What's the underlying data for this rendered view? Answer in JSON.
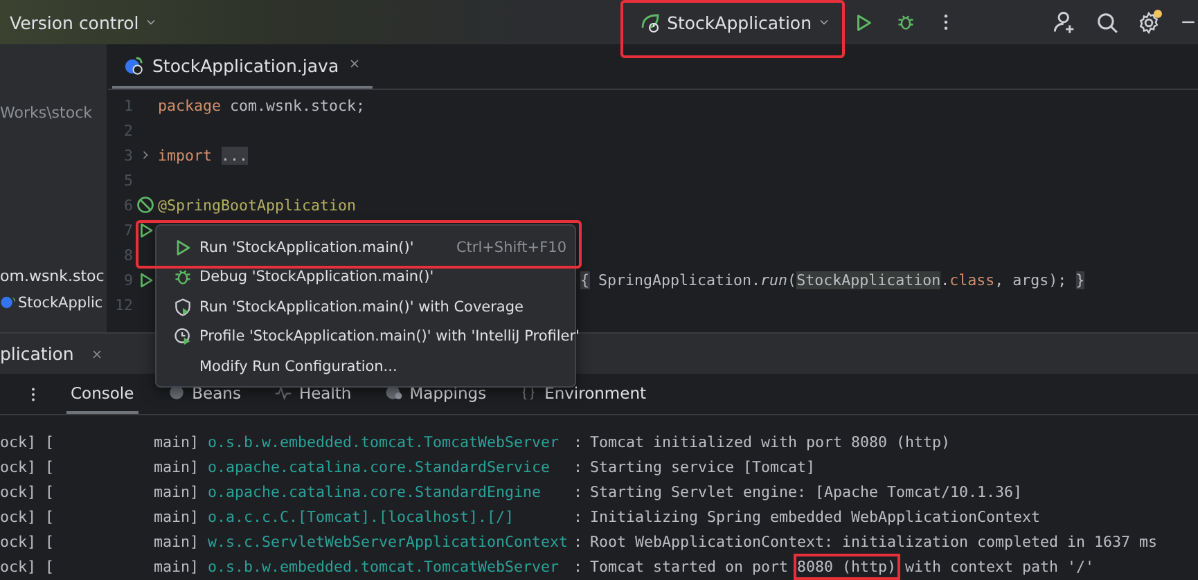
{
  "top_bar": {
    "project_menu": "Version control",
    "run_group": {
      "label": "StockApplication",
      "highlighted": true
    }
  },
  "project_pane": {
    "items": [
      {
        "text": "Works\\stock",
        "kind": "path"
      },
      {
        "text": "om.wsnk.stoc",
        "kind": "package"
      },
      {
        "text": "StockApplic",
        "kind": "class"
      }
    ]
  },
  "editor": {
    "tab": {
      "title": "StockApplication.java"
    },
    "lines": [
      {
        "number": "1",
        "kind": "plain",
        "covered": false,
        "tokens": [
          {
            "text": "package",
            "kind": "keyword"
          },
          {
            "text": " com.wsnk.stock;",
            "kind": "plain"
          }
        ]
      },
      {
        "number": "2",
        "kind": "plain"
      },
      {
        "number": "3",
        "kind": "fold",
        "covered": false,
        "tokens": [
          {
            "text": "import",
            "kind": "keyword"
          },
          {
            "text": "...",
            "kind": "folded"
          }
        ]
      },
      {
        "number": "5",
        "kind": "plain"
      },
      {
        "number": "6",
        "kind": "bean",
        "covered": false,
        "tokens": [
          {
            "text": "@SpringBootApplication",
            "kind": "annotation"
          }
        ]
      },
      {
        "number": "7",
        "kind": "run"
      },
      {
        "number": "8",
        "kind": "plain"
      },
      {
        "number": "9",
        "kind": "run",
        "covered": true,
        "tokens": [
          {
            "text": "{",
            "kind": "brace"
          },
          {
            "text": " SpringApplication.",
            "kind": "plain"
          },
          {
            "text": "run",
            "kind": "italic"
          },
          {
            "text": "(",
            "kind": "plain"
          },
          {
            "text": "StockApplication",
            "kind": "match"
          },
          {
            "text": ".",
            "kind": "plain"
          },
          {
            "text": "class",
            "kind": "keyword"
          },
          {
            "text": ", args); ",
            "kind": "plain"
          },
          {
            "text": "}",
            "kind": "brace"
          }
        ]
      },
      {
        "number": "12",
        "kind": "plain"
      }
    ]
  },
  "context_menu": {
    "items": [
      {
        "label": "Run 'StockApplication.main()'",
        "shortcut": "Ctrl+Shift+F10",
        "kind": "run",
        "highlighted": true
      },
      {
        "label": "Debug 'StockApplication.main()'",
        "kind": "debug",
        "highlighted": false
      },
      {
        "label": "Run 'StockApplication.main()' with Coverage",
        "kind": "coverage",
        "highlighted": false
      },
      {
        "label": "Profile 'StockApplication.main()' with 'IntelliJ Profiler'",
        "kind": "profiler",
        "highlighted": false
      },
      {
        "label": "Modify Run Configuration...",
        "kind": "plain",
        "highlighted": false
      }
    ]
  },
  "run_window": {
    "title": "plication",
    "tabs": [
      {
        "label": "Console",
        "kind": "plain",
        "selected": true
      },
      {
        "label": "Beans",
        "kind": "beans",
        "selected": false
      },
      {
        "label": "Health",
        "kind": "health",
        "selected": false
      },
      {
        "label": "Mappings",
        "kind": "mappings",
        "selected": false
      },
      {
        "label": "Environment",
        "kind": "environment",
        "selected": false
      }
    ],
    "log": [
      {
        "source": "ock] [",
        "thread": "main]",
        "logger": "o.s.b.w.embedded.tomcat.TomcatWebServer",
        "separator": ":",
        "message": [
          {
            "text": "Tomcat initialized with port 8080 (http)",
            "highlighted": false
          }
        ]
      },
      {
        "source": "ock] [",
        "thread": "main]",
        "logger": "o.apache.catalina.core.StandardService",
        "separator": ":",
        "message": [
          {
            "text": "Starting service [Tomcat]",
            "highlighted": false
          }
        ]
      },
      {
        "source": "ock] [",
        "thread": "main]",
        "logger": "o.apache.catalina.core.StandardEngine",
        "separator": ":",
        "message": [
          {
            "text": "Starting Servlet engine: [Apache Tomcat/10.1.36]",
            "highlighted": false
          }
        ]
      },
      {
        "source": "ock] [",
        "thread": "main]",
        "logger": "o.a.c.c.C.[Tomcat].[localhost].[/]",
        "separator": ":",
        "message": [
          {
            "text": "Initializing Spring embedded WebApplicationContext",
            "highlighted": false
          }
        ]
      },
      {
        "source": "ock] [",
        "thread": "main]",
        "logger": "w.s.c.ServletWebServerApplicationContext",
        "separator": ":",
        "message": [
          {
            "text": "Root WebApplicationContext: initialization completed in 1637 ms",
            "highlighted": false
          }
        ]
      },
      {
        "source": "ock] [",
        "thread": "main]",
        "logger": "o.s.b.w.embedded.tomcat.TomcatWebServer",
        "separator": ":",
        "message": [
          {
            "text": "Tomcat started on port ",
            "highlighted": false
          },
          {
            "text": "8080 (http)",
            "highlighted": true
          },
          {
            "text": " with context path '/'",
            "highlighted": false
          }
        ]
      }
    ]
  }
}
